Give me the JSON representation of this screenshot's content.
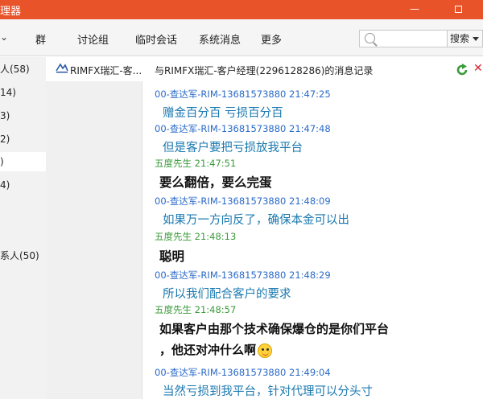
{
  "window": {
    "title": "理器"
  },
  "nav": {
    "items": [
      "群",
      "讨论组",
      "临时会话",
      "系统消息",
      "更多"
    ],
    "search_placeholder": "",
    "search_button": "搜索"
  },
  "sidebar": {
    "items": [
      "人(58)",
      "14)",
      "3)",
      "2)",
      ")",
      "4)",
      "系人(50)"
    ]
  },
  "tab": {
    "label": "RIMFX瑞汇-客..."
  },
  "chat": {
    "header": "与RIMFX瑞汇-客户经理(2296128286)的消息记录",
    "messages": [
      {
        "role": "agent",
        "sender": "00-查达军-RIM-13681573880",
        "time": "21:47:25",
        "lines": [
          "赠金百分百  亏损百分百"
        ]
      },
      {
        "role": "agent",
        "sender": "00-查达军-RIM-13681573880",
        "time": "21:47:48",
        "lines": [
          "但是客户要把亏损放我平台"
        ]
      },
      {
        "role": "customer",
        "sender": "五度先生",
        "time": "21:47:51",
        "lines": [
          "要么翻倍，要么完蛋"
        ]
      },
      {
        "role": "agent",
        "sender": "00-查达军-RIM-13681573880",
        "time": "21:48:09",
        "lines": [
          "如果万一方向反了，确保本金可以出"
        ]
      },
      {
        "role": "customer",
        "sender": "五度先生",
        "time": "21:48:13",
        "lines": [
          "聪明"
        ]
      },
      {
        "role": "agent",
        "sender": "00-查达军-RIM-13681573880",
        "time": "21:48:29",
        "lines": [
          "所以我们配合客户的要求"
        ]
      },
      {
        "role": "customer",
        "sender": "五度先生",
        "time": "21:48:57",
        "lines": [
          "如果客户由那个技术确保爆仓的是你们平台",
          "，他还对冲什么啊"
        ]
      },
      {
        "role": "agent",
        "sender": "00-查达军-RIM-13681573880",
        "time": "21:49:04",
        "lines": [
          "当然亏损到我平台，针对代理可以分头寸"
        ]
      }
    ]
  }
}
